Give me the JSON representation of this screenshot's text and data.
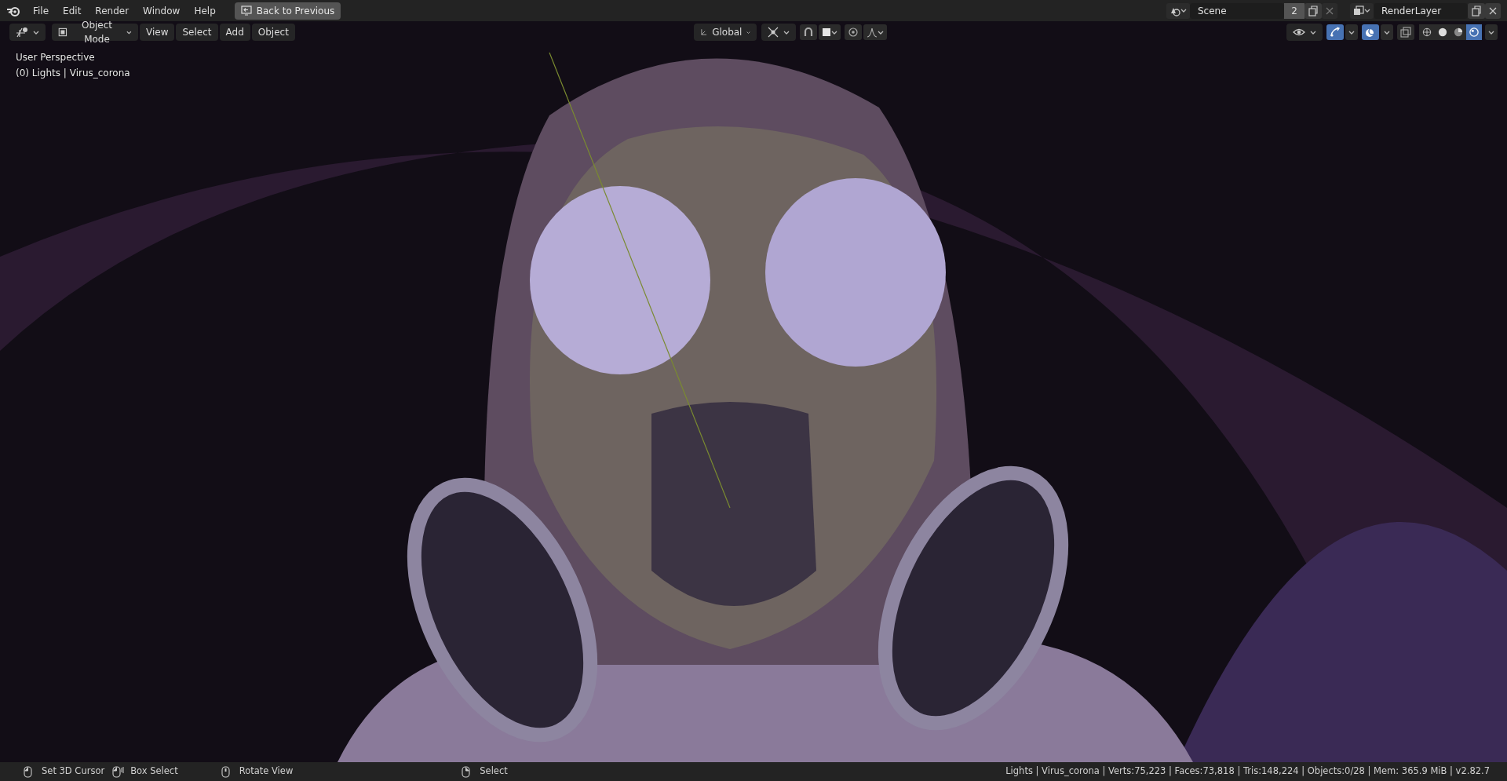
{
  "topbar": {
    "menus": [
      "File",
      "Edit",
      "Render",
      "Window",
      "Help"
    ],
    "back_button": "Back to Previous",
    "scene": {
      "name": "Scene",
      "users": "2"
    },
    "view_layer": {
      "name": "RenderLayer"
    }
  },
  "viewport_header": {
    "mode": "Object Mode",
    "menus": [
      "View",
      "Select",
      "Add",
      "Object"
    ],
    "orientation": "Global",
    "toggles": [
      {
        "kind": "snap",
        "on": false
      },
      {
        "kind": "proportional",
        "on": false
      },
      {
        "kind": "gizmos",
        "on": true
      },
      {
        "kind": "overlays",
        "on": true
      },
      {
        "kind": "xray",
        "on": false
      }
    ],
    "shading": [
      {
        "kind": "wireframe",
        "selected": false
      },
      {
        "kind": "solid",
        "selected": false
      },
      {
        "kind": "material",
        "selected": false
      },
      {
        "kind": "rendered",
        "selected": true
      }
    ]
  },
  "viewport": {
    "perspective": "User Perspective",
    "object_info": "(0) Lights | Virus_corona",
    "kind": "picture"
  },
  "status_bar": {
    "hints": [
      {
        "kind": "left",
        "label": "Set 3D Cursor"
      },
      {
        "kind": "drag",
        "label": "Box Select"
      },
      {
        "kind": "middle",
        "label": "Rotate View"
      },
      {
        "kind": "right",
        "label": "Select"
      }
    ],
    "stats": "Lights | Virus_corona | Verts:75,223 | Faces:73,818 | Tris:148,224 | Objects:0/28 | Mem: 365.9 MiB | v2.82.7"
  }
}
